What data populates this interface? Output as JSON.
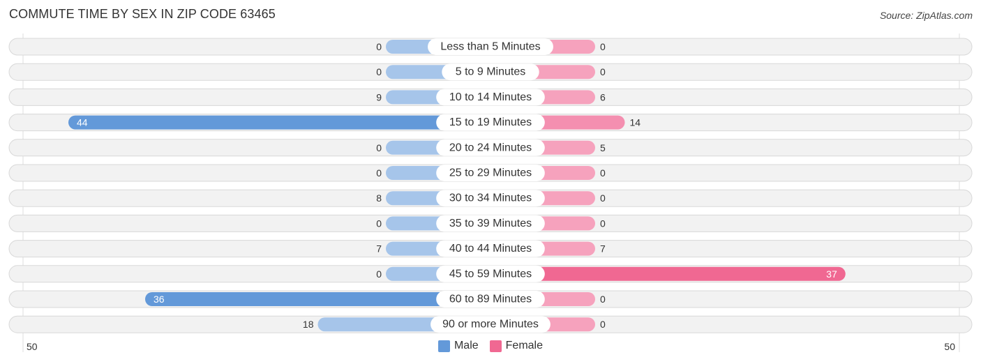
{
  "header": {
    "title": "COMMUTE TIME BY SEX IN ZIP CODE 63465",
    "source": "Source: ZipAtlas.com"
  },
  "colors": {
    "male_strong": "#6399d9",
    "male_light": "#a6c5ea",
    "female_strong": "#f06892",
    "female_light": "#f6a2bd"
  },
  "chart_data": {
    "type": "bar",
    "orientation": "horizontal-diverging",
    "title": "COMMUTE TIME BY SEX IN ZIP CODE 63465",
    "categories": [
      "Less than 5 Minutes",
      "5 to 9 Minutes",
      "10 to 14 Minutes",
      "15 to 19 Minutes",
      "20 to 24 Minutes",
      "25 to 29 Minutes",
      "30 to 34 Minutes",
      "35 to 39 Minutes",
      "40 to 44 Minutes",
      "45 to 59 Minutes",
      "60 to 89 Minutes",
      "90 or more Minutes"
    ],
    "series": [
      {
        "name": "Male",
        "values": [
          0,
          0,
          9,
          44,
          0,
          0,
          8,
          0,
          7,
          0,
          36,
          18
        ]
      },
      {
        "name": "Female",
        "values": [
          0,
          0,
          6,
          14,
          5,
          0,
          0,
          0,
          7,
          37,
          0,
          0
        ]
      }
    ],
    "axis": {
      "left_label": "50",
      "right_label": "50",
      "range": [
        -50,
        50
      ]
    },
    "legend": {
      "position": "bottom-center",
      "entries": [
        "Male",
        "Female"
      ]
    },
    "grid": false
  }
}
